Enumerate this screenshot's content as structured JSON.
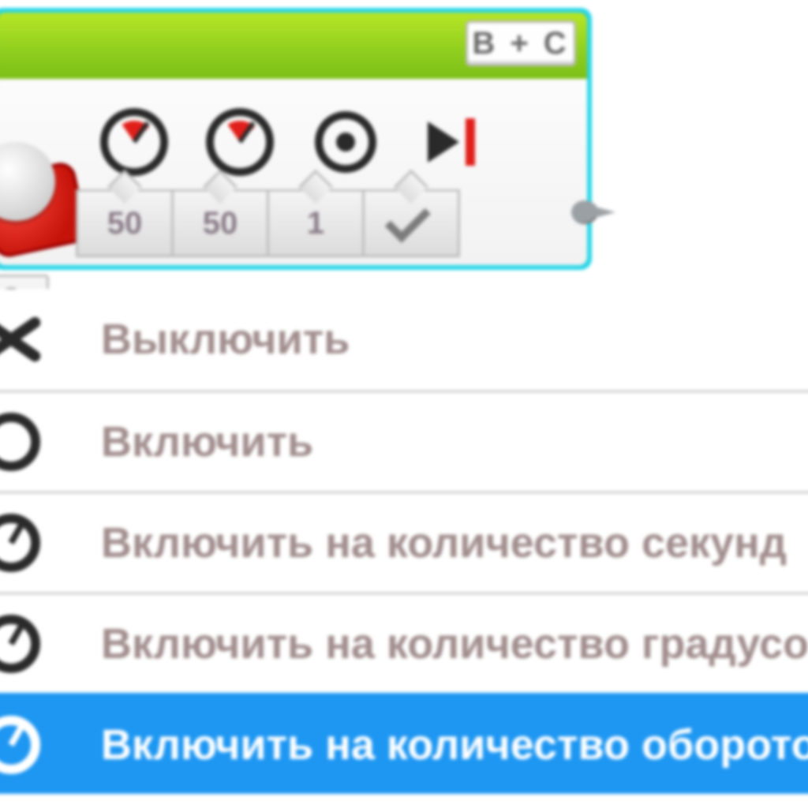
{
  "block": {
    "port_label": "B + C",
    "params": {
      "power_left": "50",
      "power_right": "50",
      "rotations": "1"
    },
    "icons": [
      "timer-power-left",
      "timer-power-right",
      "rotations",
      "brake-end"
    ],
    "motor_icon": "tank-motor-icon",
    "connector_icon": "data-plug-icon",
    "mode_selector_icon": "mode-ring-icon"
  },
  "menu": {
    "items": [
      {
        "icon": "off-icon",
        "label": "Выключить"
      },
      {
        "icon": "on-icon",
        "label": "Включить"
      },
      {
        "icon": "seconds-icon",
        "label": "Включить на количество секунд"
      },
      {
        "icon": "degrees-icon",
        "label": "Включить на количество градусов"
      },
      {
        "icon": "rotations-icon",
        "label": "Включить на количество оборотов"
      }
    ],
    "selected_index": 4
  }
}
